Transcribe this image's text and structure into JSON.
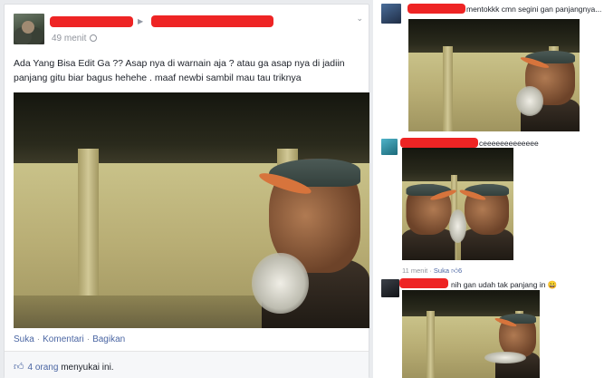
{
  "post": {
    "time": "49 menit",
    "text": "Ada Yang Bisa Edit Ga ?? Asap nya di warnain aja ? atau ga asap nya di jadiin panjang gitu biar bagus hehehe . maaf newbi sambil mau tau triknya",
    "actions": [
      "Suka",
      "Komentari",
      "Bagikan"
    ],
    "likes_count": "4 orang",
    "likes_suffix": "menyukai ini."
  },
  "comments": [
    {
      "text": "mentokkk cmn segini gan panjangnya..."
    },
    {
      "text": "ceeeeeeeeeeeee",
      "time": "11 menit",
      "like_label": "Suka",
      "like_count": "6"
    },
    {
      "text": "nih gan udah tak panjang in 😀"
    }
  ],
  "colors": {
    "redaction": "#ee2424",
    "link": "#4b66a3",
    "page_bg": "#e9ebee"
  }
}
